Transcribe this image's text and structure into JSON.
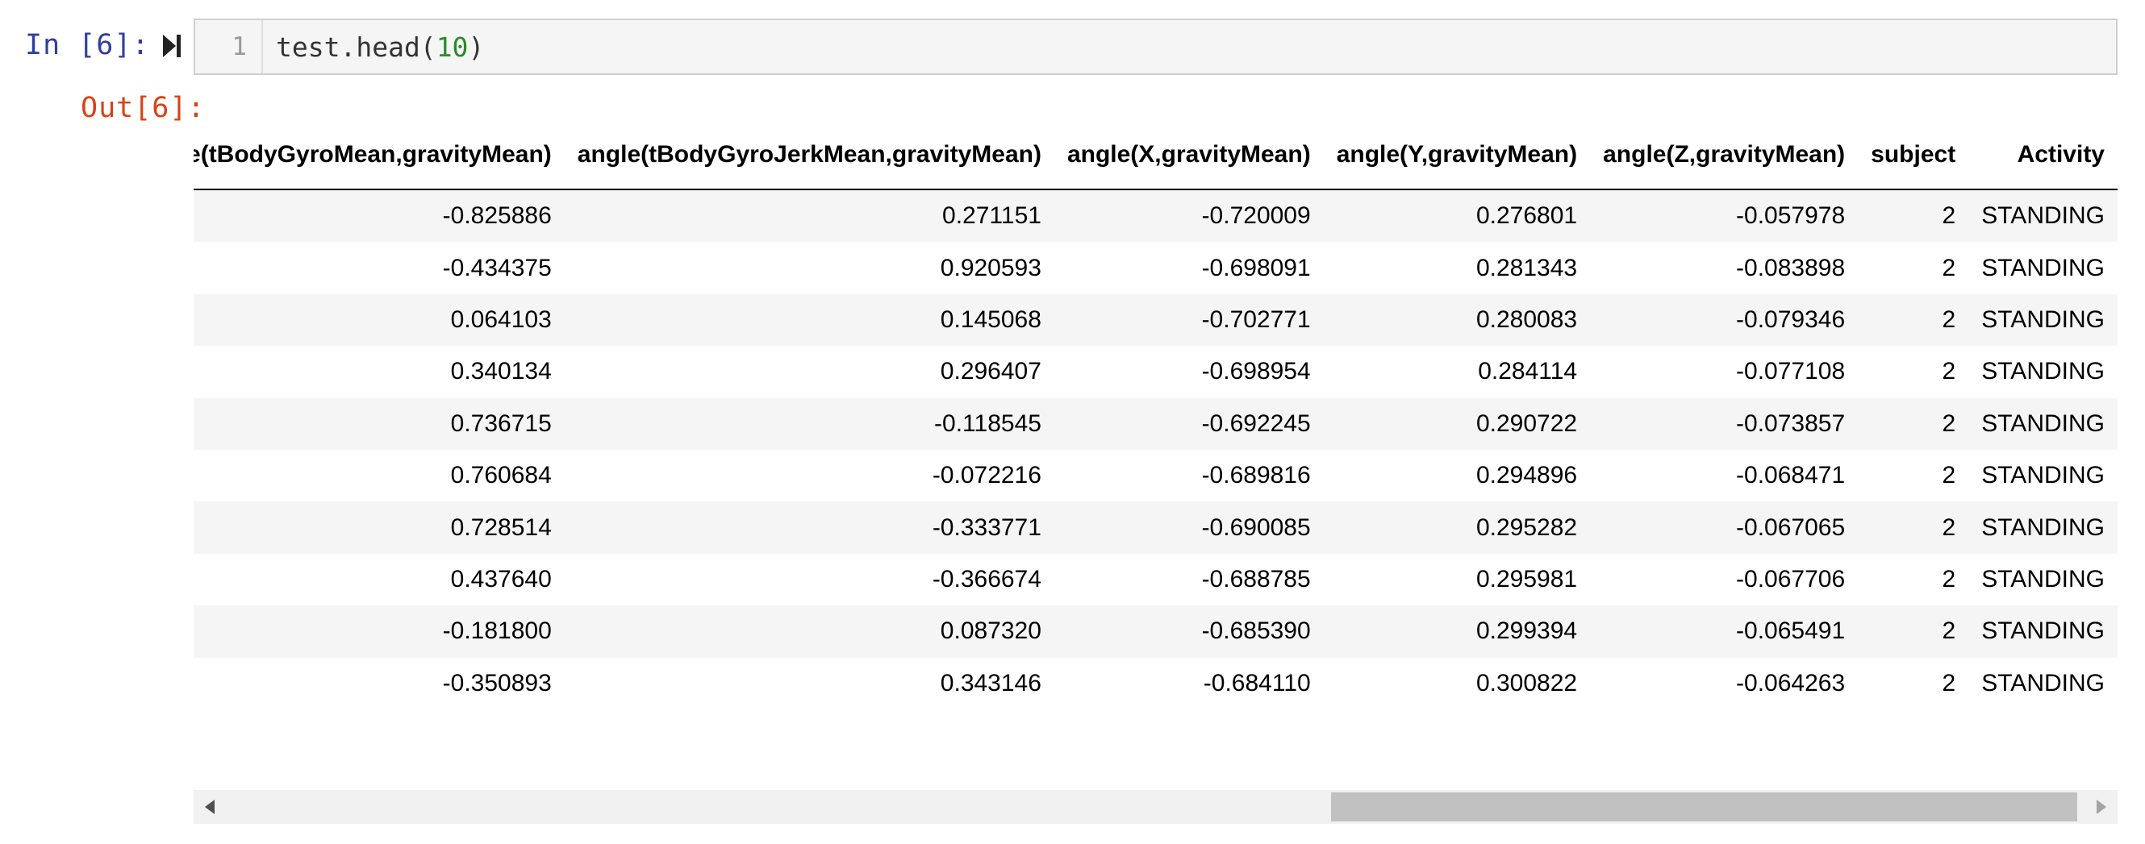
{
  "cell": {
    "in_prompt": "In [6]:",
    "out_prompt": "Out[6]:",
    "line_number": "1",
    "code_prefix": "test.head(",
    "code_arg": "10",
    "code_suffix": ")"
  },
  "scrollbar": {
    "thumb_start": 0.591,
    "thumb_end": 0.979
  },
  "table": {
    "columns": [
      "angle(tBodyGyroMean,gravityMean)",
      "angle(tBodyGyroJerkMean,gravityMean)",
      "angle(X,gravityMean)",
      "angle(Y,gravityMean)",
      "angle(Z,gravityMean)",
      "subject",
      "Activity"
    ],
    "rows": [
      [
        "-0.825886",
        "0.271151",
        "-0.720009",
        "0.276801",
        "-0.057978",
        "2",
        "STANDING"
      ],
      [
        "-0.434375",
        "0.920593",
        "-0.698091",
        "0.281343",
        "-0.083898",
        "2",
        "STANDING"
      ],
      [
        "0.064103",
        "0.145068",
        "-0.702771",
        "0.280083",
        "-0.079346",
        "2",
        "STANDING"
      ],
      [
        "0.340134",
        "0.296407",
        "-0.698954",
        "0.284114",
        "-0.077108",
        "2",
        "STANDING"
      ],
      [
        "0.736715",
        "-0.118545",
        "-0.692245",
        "0.290722",
        "-0.073857",
        "2",
        "STANDING"
      ],
      [
        "0.760684",
        "-0.072216",
        "-0.689816",
        "0.294896",
        "-0.068471",
        "2",
        "STANDING"
      ],
      [
        "0.728514",
        "-0.333771",
        "-0.690085",
        "0.295282",
        "-0.067065",
        "2",
        "STANDING"
      ],
      [
        "0.437640",
        "-0.366674",
        "-0.688785",
        "0.295981",
        "-0.067706",
        "2",
        "STANDING"
      ],
      [
        "-0.181800",
        "0.087320",
        "-0.685390",
        "0.299394",
        "-0.065491",
        "2",
        "STANDING"
      ],
      [
        "-0.350893",
        "0.343146",
        "-0.684110",
        "0.300822",
        "-0.064263",
        "2",
        "STANDING"
      ]
    ]
  }
}
